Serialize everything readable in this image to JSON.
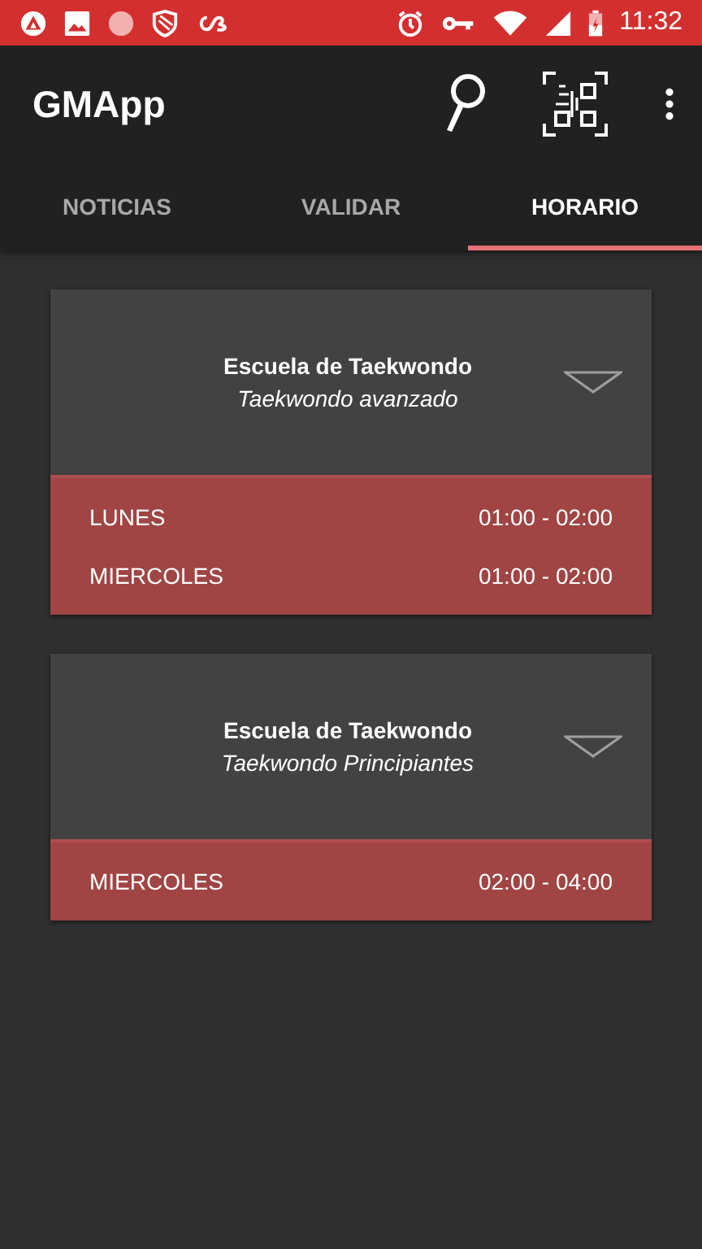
{
  "status_bar": {
    "time": "11:32"
  },
  "app_bar": {
    "title": "GMApp"
  },
  "tabs": [
    {
      "label": "NOTICIAS",
      "selected": false
    },
    {
      "label": "VALIDAR",
      "selected": false
    },
    {
      "label": "HORARIO",
      "selected": true
    }
  ],
  "cards": [
    {
      "title": "Escuela de Taekwondo",
      "subtitle": "Taekwondo avanzado",
      "expanded": true,
      "rows": [
        {
          "day": "LUNES",
          "time": "01:00 - 02:00"
        },
        {
          "day": "MIERCOLES",
          "time": "01:00 - 02:00"
        }
      ]
    },
    {
      "title": "Escuela de Taekwondo",
      "subtitle": "Taekwondo Principiantes",
      "expanded": true,
      "rows": [
        {
          "day": "MIERCOLES",
          "time": "02:00 - 04:00"
        }
      ]
    }
  ]
}
